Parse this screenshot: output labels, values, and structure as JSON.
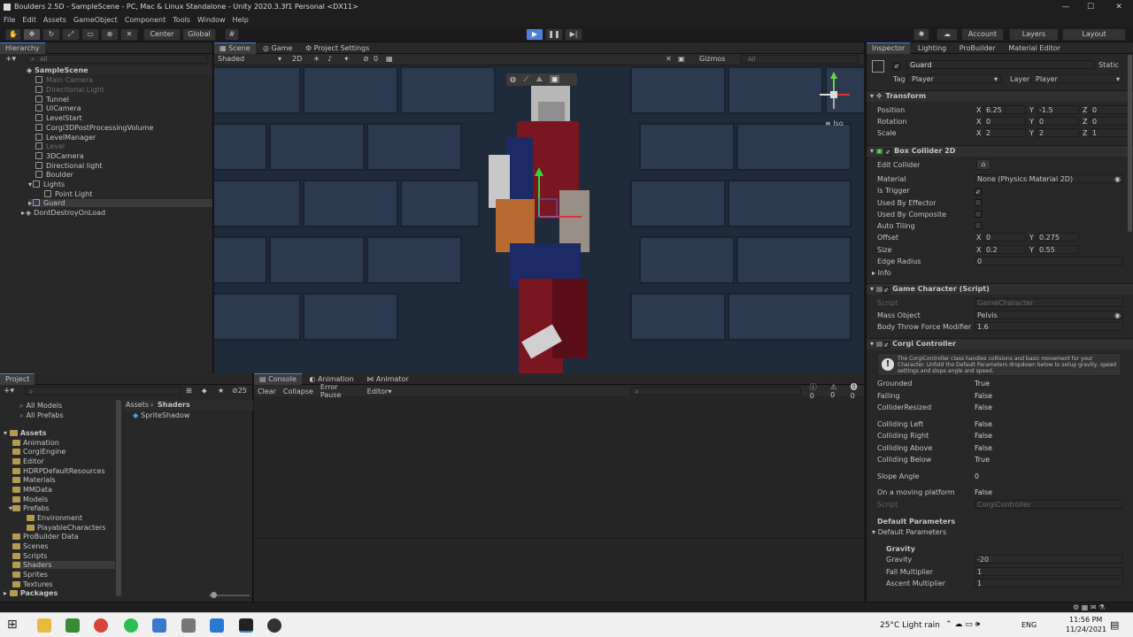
{
  "window": {
    "title": "Boulders 2.5D - SampleScene - PC, Mac & Linux Standalone - Unity 2020.3.3f1 Personal <DX11>"
  },
  "menu": [
    "File",
    "Edit",
    "Assets",
    "GameObject",
    "Component",
    "Tools",
    "Window",
    "Help"
  ],
  "toolbar": {
    "center": "Center",
    "global": "Global",
    "account": "Account",
    "layers": "Layers",
    "layout": "Layout"
  },
  "hierarchy": {
    "tab": "Hierarchy",
    "search_placeholder": "All",
    "scene": "SampleScene",
    "items": [
      "Main Camera",
      "Directional Light",
      "Tunnel",
      "UICamera",
      "LevelStart",
      "Corgi3DPostProcessingVolume",
      "LevelManager",
      "Level",
      "3DCamera",
      "Directional light",
      "Boulder",
      "Lights",
      "Point Light",
      "Guard",
      "DontDestroyOnLoad"
    ]
  },
  "scene_view": {
    "tabs": [
      "Scene",
      "Game",
      "Project Settings"
    ],
    "shading": "Shaded",
    "mode_2d": "2D",
    "gizmos": "Gizmos",
    "search_placeholder": "All",
    "hidden_count": "0",
    "iso": "Iso"
  },
  "inspector": {
    "tabs": [
      "Inspector",
      "Lighting",
      "ProBuilder",
      "Material Editor"
    ],
    "object_name": "Guard",
    "static": "Static",
    "tag_label": "Tag",
    "tag": "Player",
    "layer_label": "Layer",
    "layer": "Player",
    "transform": {
      "title": "Transform",
      "position": {
        "label": "Position",
        "x": "6.25",
        "y": "-1.5",
        "z": "0"
      },
      "rotation": {
        "label": "Rotation",
        "x": "0",
        "y": "0",
        "z": "0"
      },
      "scale": {
        "label": "Scale",
        "x": "2",
        "y": "2",
        "z": "1"
      }
    },
    "box_collider": {
      "title": "Box Collider 2D",
      "edit_collider": "Edit Collider",
      "material_label": "Material",
      "material": "None (Physics Material 2D)",
      "is_trigger": "Is Trigger",
      "used_by_effector": "Used By Effector",
      "used_by_composite": "Used By Composite",
      "auto_tiling": "Auto Tiling",
      "offset_label": "Offset",
      "offset_x": "0",
      "offset_y": "0.275",
      "size_label": "Size",
      "size_x": "0.2",
      "size_y": "0.55",
      "edge_radius_label": "Edge Radius",
      "edge_radius": "0",
      "info": "Info"
    },
    "game_character": {
      "title": "Game Character (Script)",
      "script_label": "Script",
      "script": "GameCharacter",
      "mass_object_label": "Mass Object",
      "mass_object": "Pelvis",
      "throw_label": "Body Throw Force Modifier",
      "throw": "1.6"
    },
    "corgi_controller": {
      "title": "Corgi Controller",
      "help": "The CorgiController class handles collisions and basic movement for your Character. Unfold the Default Parameters dropdown below to setup gravity, speed settings and slope angle and speed.",
      "states": [
        {
          "label": "Grounded",
          "value": "True"
        },
        {
          "label": "Falling",
          "value": "False"
        },
        {
          "label": "ColliderResized",
          "value": "False"
        },
        {
          "label": "Colliding Left",
          "value": "False"
        },
        {
          "label": "Colliding Right",
          "value": "False"
        },
        {
          "label": "Colliding Above",
          "value": "False"
        },
        {
          "label": "Colliding Below",
          "value": "True"
        },
        {
          "label": "Slope Angle",
          "value": "0"
        },
        {
          "label": "On a moving platform",
          "value": "False"
        }
      ],
      "script_label": "Script",
      "script": "CorgiController",
      "default_params_header": "Default Parameters",
      "default_params_fold": "Default Parameters",
      "gravity_header": "Gravity",
      "gravity_label": "Gravity",
      "gravity": "-20",
      "fall_label": "Fall Multiplier",
      "fall": "1",
      "ascent_label": "Ascent Multiplier",
      "ascent": "1"
    }
  },
  "project": {
    "tab": "Project",
    "count": "25",
    "favorites": [
      "All Models",
      "All Prefabs"
    ],
    "breadcrumb_root": "Assets",
    "breadcrumb_current": "Shaders",
    "asset_file": "SpriteShadow",
    "tree_root": "Assets",
    "tree": [
      "Animation",
      "CorgiEngine",
      "Editor",
      "HDRPDefaultResources",
      "Materials",
      "MMData",
      "Models",
      "Prefabs",
      "Environment",
      "PlayableCharacters",
      "ProBuilder Data",
      "Scenes",
      "Scripts",
      "Shaders",
      "Sprites",
      "Textures"
    ],
    "packages": "Packages"
  },
  "console": {
    "tabs": [
      "Console",
      "Animation",
      "Animator"
    ],
    "buttons": [
      "Clear",
      "Collapse",
      "Error Pause",
      "Editor"
    ],
    "counts": [
      "0",
      "0",
      "0"
    ]
  },
  "taskbar": {
    "weather": "25°C  Light rain",
    "lang": "ENG",
    "time": "11:56 PM",
    "date": "11/24/2021"
  },
  "colors": {
    "accent": "#4d7fd8",
    "bg": "#282828",
    "viewport": "#1f2a3a"
  }
}
